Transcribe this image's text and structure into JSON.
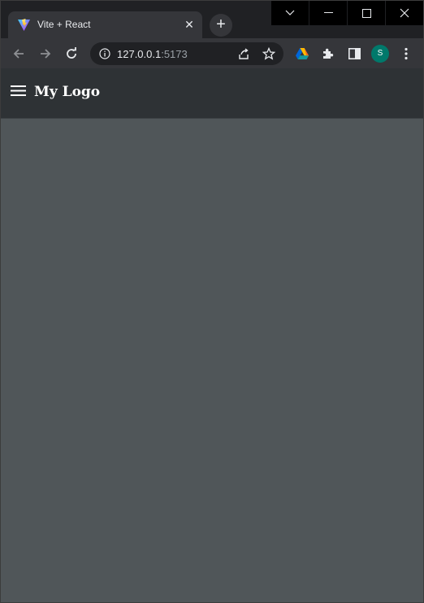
{
  "browser": {
    "tab": {
      "title": "Vite + React",
      "favicon": "vite-icon"
    },
    "new_tab_icon": "plus-icon",
    "window_controls": [
      "chevron-down-icon",
      "minimize-icon",
      "maximize-icon",
      "close-icon"
    ],
    "toolbar": {
      "back_icon": "arrow-left-icon",
      "forward_icon": "arrow-right-icon",
      "reload_icon": "reload-icon",
      "site_info_icon": "info-icon",
      "url_host": "127.0.0.1",
      "url_port": ":5173",
      "share_icon": "share-icon",
      "bookmark_icon": "star-icon",
      "extensions": [
        "google-drive-icon",
        "puzzle-icon",
        "side-panel-icon"
      ],
      "profile_initial": "S",
      "menu_icon": "kebab-menu-icon"
    }
  },
  "app": {
    "navbar": {
      "menu_icon": "hamburger-icon",
      "brand": "My Logo"
    }
  },
  "colors": {
    "tab_bg": "#35363a",
    "omnibox_bg": "#202124",
    "navbar_bg": "#2e3235",
    "page_bg": "#505659",
    "avatar_bg": "#00796b"
  }
}
